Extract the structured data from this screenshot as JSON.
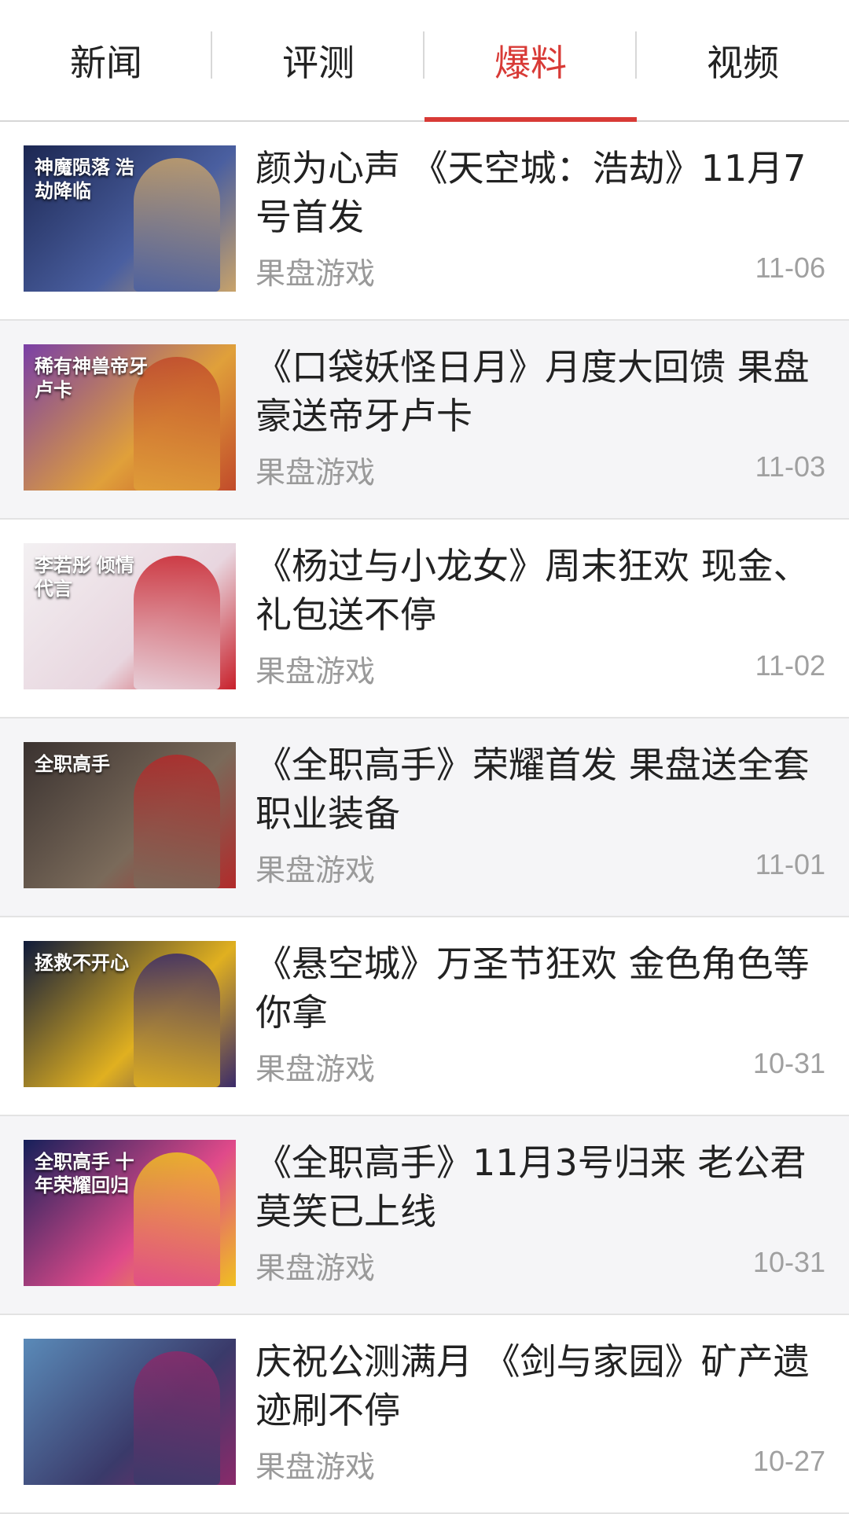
{
  "tabs": [
    {
      "label": "新闻",
      "active": false
    },
    {
      "label": "评测",
      "active": false
    },
    {
      "label": "爆料",
      "active": true
    },
    {
      "label": "视频",
      "active": false
    }
  ],
  "accent_color": "#d83a36",
  "articles": [
    {
      "title": "颜为心声 《天空城：浩劫》11月7号首发",
      "source": "果盘游戏",
      "date": "11-06",
      "thumb_caption": "神魔陨落 浩劫降临",
      "thumb_colors": [
        "#1c2752",
        "#4a5fa0",
        "#c9a36a"
      ]
    },
    {
      "title": "《口袋妖怪日月》月度大回馈 果盘豪送帝牙卢卡",
      "source": "果盘游戏",
      "date": "11-03",
      "thumb_caption": "稀有神兽帝牙卢卡",
      "thumb_colors": [
        "#7a3fa6",
        "#e0a03a",
        "#c14a2a"
      ]
    },
    {
      "title": "《杨过与小龙女》周末狂欢 现金、礼包送不停",
      "source": "果盘游戏",
      "date": "11-02",
      "thumb_caption": "李若彤 倾情代言",
      "thumb_colors": [
        "#f3f0f2",
        "#e8d6df",
        "#c8202a"
      ]
    },
    {
      "title": "《全职高手》荣耀首发 果盘送全套职业装备",
      "source": "果盘游戏",
      "date": "11-01",
      "thumb_caption": "全职高手",
      "thumb_colors": [
        "#3a3230",
        "#7a6a5a",
        "#b22a2a"
      ]
    },
    {
      "title": "《悬空城》万圣节狂欢 金色角色等你拿",
      "source": "果盘游戏",
      "date": "10-31",
      "thumb_caption": "拯救不开心",
      "thumb_colors": [
        "#0f1a3a",
        "#e0b020",
        "#3a2a6a"
      ]
    },
    {
      "title": "《全职高手》11月3号归来 老公君莫笑已上线",
      "source": "果盘游戏",
      "date": "10-31",
      "thumb_caption": "全职高手 十年荣耀回归",
      "thumb_colors": [
        "#16205a",
        "#e04a8a",
        "#f0c020"
      ]
    },
    {
      "title": "庆祝公测满月 《剑与家园》矿产遗迹刷不停",
      "source": "果盘游戏",
      "date": "10-27",
      "thumb_caption": "",
      "thumb_colors": [
        "#5a8ab8",
        "#3a3a6a",
        "#8a2a6a"
      ]
    }
  ]
}
